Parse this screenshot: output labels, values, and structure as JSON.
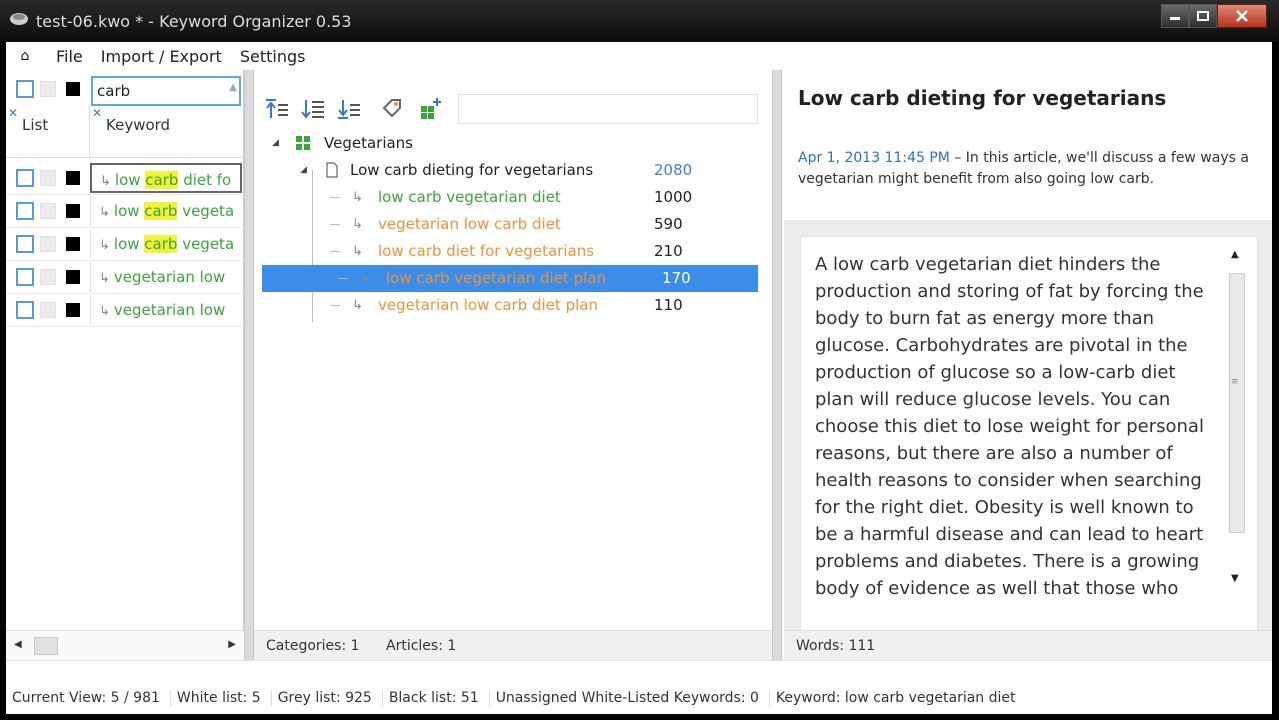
{
  "window": {
    "title": "test-06.kwo * - Keyword Organizer 0.53",
    "icons": [
      "app-icon",
      "minimize-icon",
      "maximize-icon",
      "close-icon"
    ]
  },
  "menu": {
    "home_icon": "⌂",
    "items": [
      "File",
      "Import / Export",
      "Settings"
    ]
  },
  "left": {
    "search_value": "carb",
    "columns": {
      "list": "List",
      "keyword": "Keyword"
    },
    "rows": [
      {
        "pre": "low ",
        "hl": "carb",
        "post": " diet fo"
      },
      {
        "pre": "low ",
        "hl": "carb",
        "post": " vegeta"
      },
      {
        "pre": "low ",
        "hl": "carb",
        "post": " vegeta"
      },
      {
        "pre": "vegetarian low",
        "hl": "",
        "post": ""
      },
      {
        "pre": "vegetarian low",
        "hl": "",
        "post": ""
      }
    ]
  },
  "tree": {
    "category": "Vegetarians",
    "article": {
      "title": "Low carb dieting for vegetarians",
      "count": "2080"
    },
    "keywords": [
      {
        "text": "low carb vegetarian diet",
        "count": "1000",
        "color": "green",
        "selected": false
      },
      {
        "text": "vegetarian low carb diet",
        "count": "590",
        "color": "orange",
        "selected": false
      },
      {
        "text": "low carb diet for vegetarians",
        "count": "210",
        "color": "orange",
        "selected": false
      },
      {
        "text": "low carb vegetarian diet plan",
        "count": "170",
        "color": "orange",
        "selected": true
      },
      {
        "text": "vegetarian low carb diet plan",
        "count": "110",
        "color": "orange",
        "selected": false
      }
    ],
    "status": {
      "categories": "Categories: 1",
      "articles": "Articles: 1"
    }
  },
  "article": {
    "title": "Low carb dieting for vegetarians",
    "date": "Apr 1, 2013 11:45 PM",
    "summary": " – In this article, we'll discuss a few ways a vegetarian might benefit from also going low carb.",
    "body": "A low carb vegetarian diet hinders the production and storing of fat by forcing the body to burn fat as energy more than glucose. Carbohydrates are pivotal in the production of glucose so a low-carb diet plan will reduce glucose levels. You can choose this diet to lose weight for personal reasons, but there are also a number of health reasons to consider when searching for the right diet. Obesity is well known to be a harmful disease and can lead to heart problems and diabetes. There is a growing body of evidence as well that those who",
    "words": "Words: 111"
  },
  "statusbar": {
    "current_view": "Current View: 5 / 981",
    "white_list": "White list: 5",
    "grey_list": "Grey list: 925",
    "black_list": "Black list: 51",
    "unassigned": "Unassigned White-Listed Keywords: 0",
    "keyword": "Keyword: low carb vegetarian diet"
  },
  "colors": {
    "accent": "#3b8de8",
    "green": "#3aa63a",
    "orange": "#f0923a",
    "blue": "#3a7fd8",
    "highlight": "#f2f23a"
  }
}
